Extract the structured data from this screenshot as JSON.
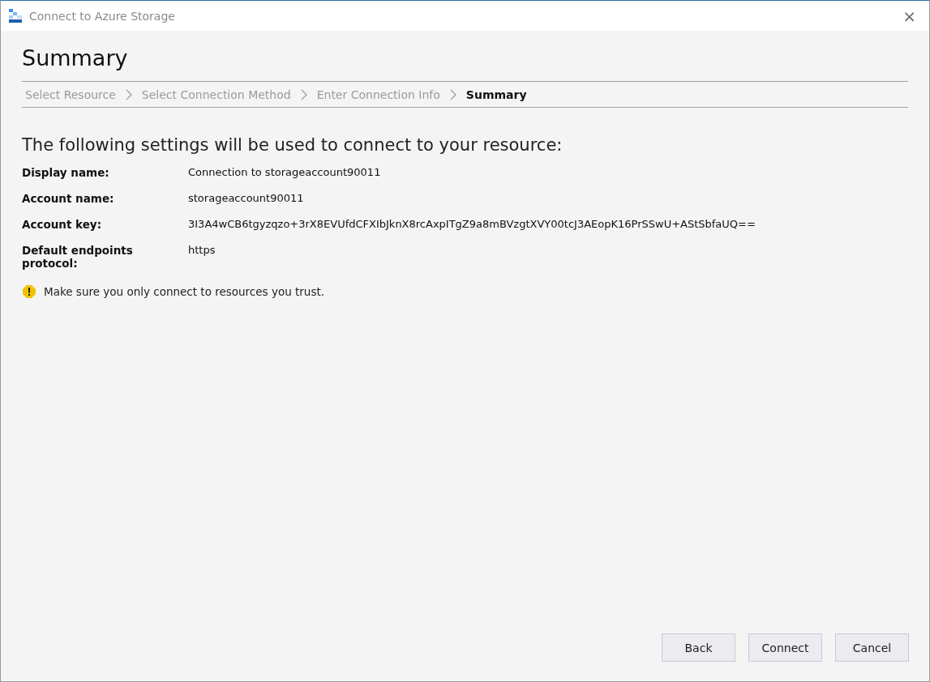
{
  "window": {
    "title": "Connect to Azure Storage",
    "close": "×"
  },
  "page_title": "Summary",
  "steps": [
    {
      "label": "Select Resource",
      "selected": false
    },
    {
      "label": "Select Connection Method",
      "selected": false
    },
    {
      "label": "Enter Connection Info",
      "selected": false
    },
    {
      "label": "Summary",
      "selected": true
    }
  ],
  "heading": "The following settings will be used to connect to your resource:",
  "settings": [
    {
      "label": "Display name:",
      "value": "Connection to storageaccount90011"
    },
    {
      "label": "Account name:",
      "value": "storageaccount90011"
    },
    {
      "label": "Account key:",
      "value": "3I3A4wCB6tgyzqzo+3rX8EVUfdCFXIbJknX8rcAxpITgZ9a8mBVzgtXVY00tcJ3AEopK16PrSSwU+AStSbfaUQ=="
    },
    {
      "label": "Default endpoints protocol:",
      "value": "https"
    }
  ],
  "warning": "Make sure you only connect to resources you trust.",
  "buttons": [
    "Back",
    "Connect",
    "Cancel"
  ]
}
